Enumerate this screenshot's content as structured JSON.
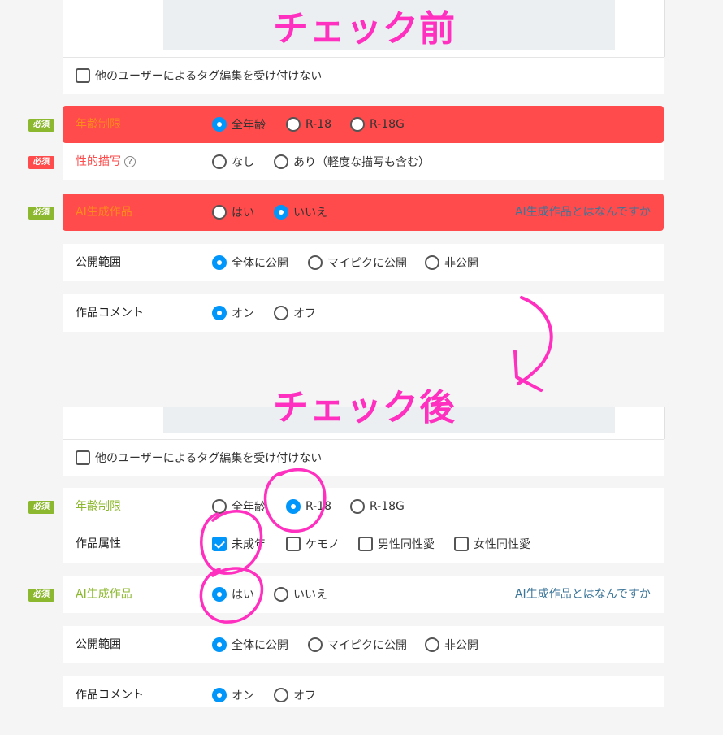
{
  "before": {
    "heading": "チェック前",
    "tag_lock_label": "他のユーザーによるタグ編集を受け付けない",
    "required_badge": "必須",
    "age": {
      "label": "年齢制限",
      "options": [
        "全年齢",
        "R-18",
        "R-18G"
      ],
      "selected": "全年齢"
    },
    "sexual": {
      "label": "性的描写",
      "help": "?",
      "options": [
        "なし",
        "あり（軽度な描写も含む）"
      ]
    },
    "ai": {
      "label": "AI生成作品",
      "options": [
        "はい",
        "いいえ"
      ],
      "selected": "いいえ",
      "link": "AI生成作品とはなんですか"
    },
    "visibility": {
      "label": "公開範囲",
      "options": [
        "全体に公開",
        "マイピクに公開",
        "非公開"
      ],
      "selected": "全体に公開"
    },
    "comment": {
      "label": "作品コメント",
      "options": [
        "オン",
        "オフ"
      ],
      "selected": "オン"
    }
  },
  "after": {
    "heading": "チェック後",
    "tag_lock_label": "他のユーザーによるタグ編集を受け付けない",
    "required_badge": "必須",
    "age": {
      "label": "年齢制限",
      "options": [
        "全年齢",
        "R-18",
        "R-18G"
      ],
      "selected": "R-18"
    },
    "attributes": {
      "label": "作品属性",
      "options": [
        "未成年",
        "ケモノ",
        "男性同性愛",
        "女性同性愛"
      ],
      "checked": [
        "未成年"
      ]
    },
    "ai": {
      "label": "AI生成作品",
      "options": [
        "はい",
        "いいえ"
      ],
      "selected": "はい",
      "link": "AI生成作品とはなんですか"
    },
    "visibility": {
      "label": "公開範囲",
      "options": [
        "全体に公開",
        "マイピクに公開",
        "非公開"
      ],
      "selected": "全体に公開"
    },
    "comment": {
      "label": "作品コメント",
      "options": [
        "オン",
        "オフ"
      ],
      "selected": "オン"
    }
  },
  "colors": {
    "accent": "#0096fa",
    "error": "#ff4b4b",
    "required_green": "#8cb82f",
    "annotation": "#ff2fbf",
    "link": "#3d7699"
  }
}
